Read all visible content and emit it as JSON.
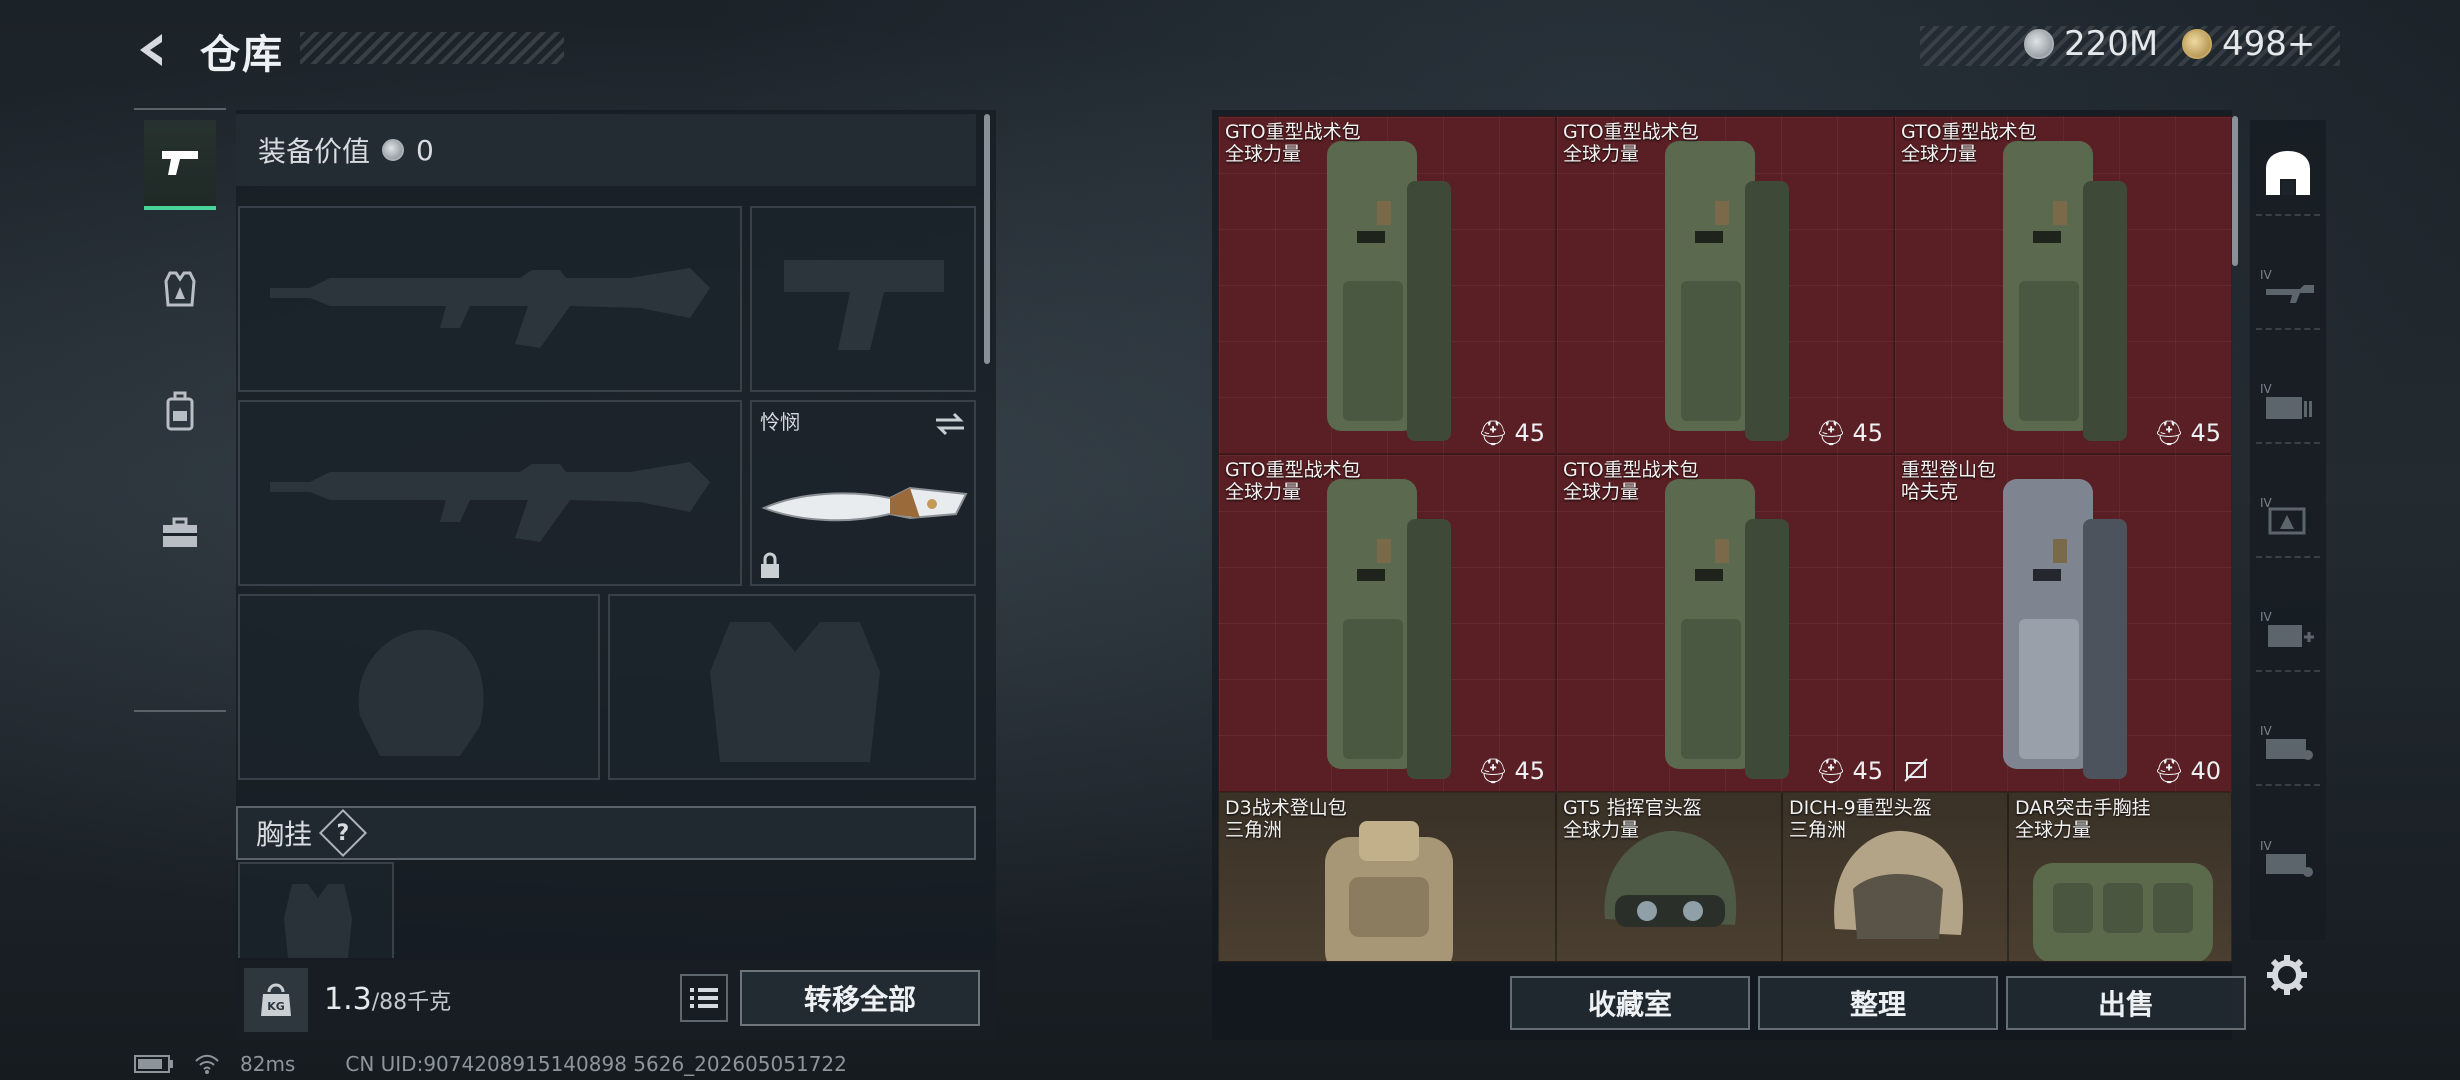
{
  "header": {
    "title": "仓库",
    "silver_amount": "220M",
    "gold_amount": "498+"
  },
  "equipment": {
    "value_label": "装备价值",
    "value": "0",
    "melee_name": "怜悯",
    "chest_label": "胸挂",
    "chest_help": "?",
    "weight_current": "1.3",
    "weight_max": "/88千克",
    "transfer_all": "转移全部"
  },
  "items": [
    {
      "name": "GTO重型战术包",
      "maker": "全球力量",
      "capacity": "45",
      "color": "green"
    },
    {
      "name": "GTO重型战术包",
      "maker": "全球力量",
      "capacity": "45",
      "color": "green"
    },
    {
      "name": "GTO重型战术包",
      "maker": "全球力量",
      "capacity": "45",
      "color": "green"
    },
    {
      "name": "GTO重型战术包",
      "maker": "全球力量",
      "capacity": "45",
      "color": "green"
    },
    {
      "name": "GTO重型战术包",
      "maker": "全球力量",
      "capacity": "45",
      "color": "green"
    },
    {
      "name": "重型登山包",
      "maker": "哈夫克",
      "capacity": "40",
      "color": "gray"
    },
    {
      "name": "D3战术登山包",
      "maker": "三角洲"
    },
    {
      "name": "GT5 指挥官头盔",
      "maker": "全球力量"
    },
    {
      "name": "DICH-9重型头盔",
      "maker": "三角洲"
    },
    {
      "name": "DAR突击手胸挂",
      "maker": "全球力量"
    }
  ],
  "grid_buttons": {
    "collection": "收藏室",
    "sort": "整理",
    "sell": "出售"
  },
  "status": {
    "ping": "82ms",
    "uid": "CN UID:9074208915140898 5626_202605051722"
  },
  "colors": {
    "accent": "#48d59a",
    "red_rarity": "#5a1f24",
    "gold_rarity": "#4a3f30"
  }
}
